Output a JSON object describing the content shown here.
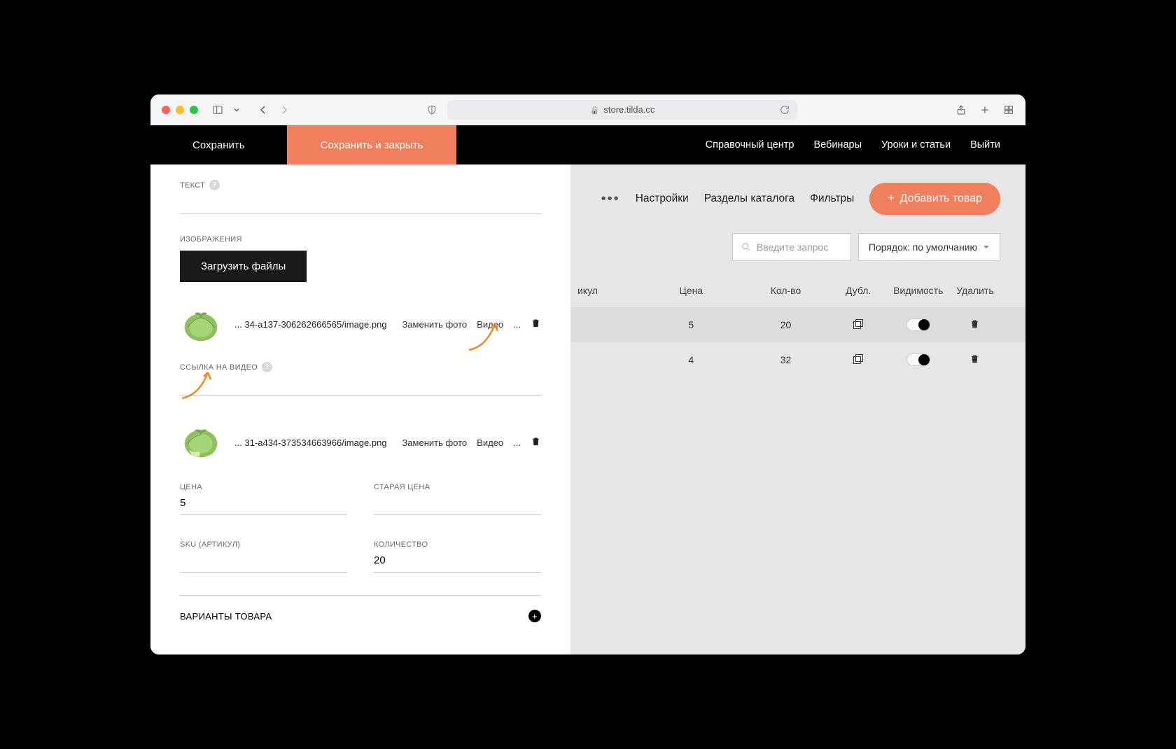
{
  "browser": {
    "url": "store.tilda.cc"
  },
  "topbar": {
    "save": "Сохранить",
    "save_close": "Сохранить и закрыть",
    "links": {
      "help": "Справочный центр",
      "webinars": "Вебинары",
      "lessons": "Уроки и статьи",
      "logout": "Выйти"
    }
  },
  "editor": {
    "text_label": "ТЕКСТ",
    "images_label": "ИЗОБРАЖЕНИЯ",
    "upload": "Загрузить файлы",
    "video_link_label": "ССЫЛКА НА ВИДЕО",
    "images": [
      {
        "name": "... 34-a137-306262666565/image.png",
        "replace": "Заменить фото",
        "video": "Видео",
        "more": "..."
      },
      {
        "name": "... 31-a434-373534663966/image.png",
        "replace": "Заменить фото",
        "video": "Видео",
        "more": "..."
      }
    ],
    "price_label": "ЦЕНА",
    "price_value": "5",
    "old_price_label": "СТАРАЯ ЦЕНА",
    "old_price_value": "",
    "sku_label": "SKU (АРТИКУЛ)",
    "sku_value": "",
    "qty_label": "КОЛИЧЕСТВО",
    "qty_value": "20",
    "variants_label": "ВАРИАНТЫ ТОВАРА"
  },
  "catalog": {
    "nav": {
      "settings": "Настройки",
      "sections": "Разделы каталога",
      "filters": "Фильтры",
      "add": "Добавить товар"
    },
    "search_placeholder": "Введите запрос",
    "sort": "Порядок: по умолчанию",
    "headers": {
      "sku": "икул",
      "price": "Цена",
      "qty": "Кол-во",
      "dup": "Дубл.",
      "vis": "Видимость",
      "del": "Удалить"
    },
    "rows": [
      {
        "price": "5",
        "qty": "20"
      },
      {
        "price": "4",
        "qty": "32"
      }
    ]
  }
}
